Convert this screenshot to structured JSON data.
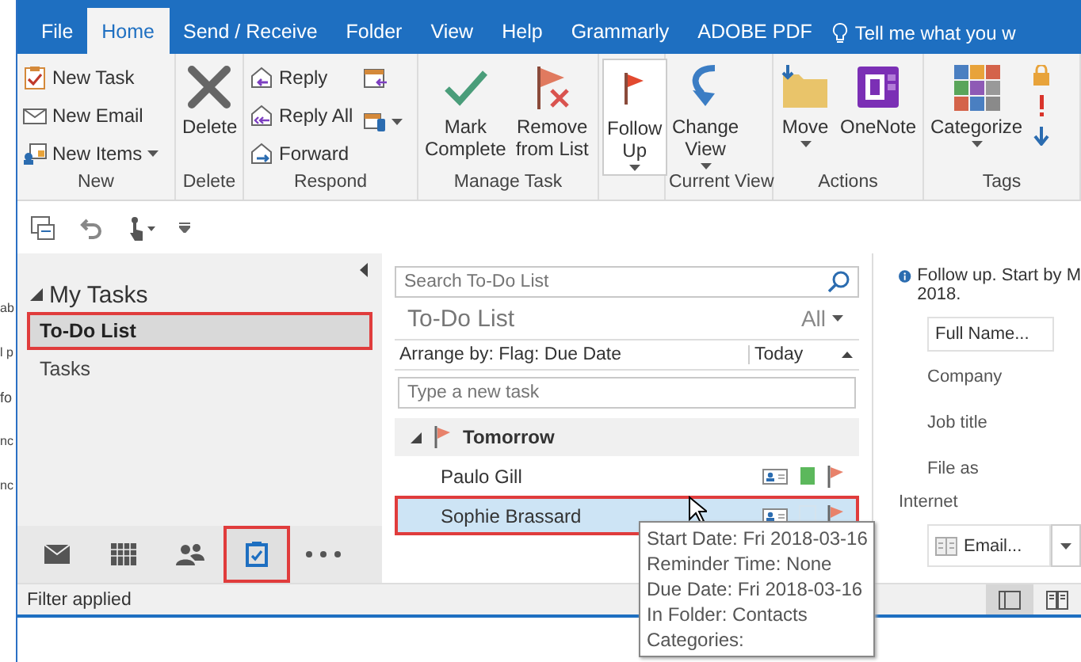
{
  "background_fragments": [
    "ab",
    "l p",
    "fo",
    "nc",
    "nc"
  ],
  "ribbon_tabs": [
    {
      "label": "File",
      "selected": false
    },
    {
      "label": "Home",
      "selected": true
    },
    {
      "label": "Send / Receive",
      "selected": false
    },
    {
      "label": "Folder",
      "selected": false
    },
    {
      "label": "View",
      "selected": false
    },
    {
      "label": "Help",
      "selected": false
    },
    {
      "label": "Grammarly",
      "selected": false
    },
    {
      "label": "ADOBE PDF",
      "selected": false
    }
  ],
  "tell_me": "Tell me what you w",
  "ribbon_groups": [
    {
      "label": "New",
      "buttons": [
        {
          "kind": "small",
          "label": "New Task",
          "dropdown": false
        },
        {
          "kind": "small",
          "label": "New Email",
          "dropdown": false
        },
        {
          "kind": "small",
          "label": "New Items",
          "dropdown": true
        }
      ]
    },
    {
      "label": "Delete",
      "buttons": [
        {
          "kind": "large",
          "label": "Delete",
          "dropdown": false
        }
      ]
    },
    {
      "label": "Respond",
      "buttons": [
        {
          "kind": "small",
          "label": "Reply",
          "dropdown": false
        },
        {
          "kind": "small",
          "label": "Reply All",
          "dropdown": false
        },
        {
          "kind": "small",
          "label": "Forward",
          "dropdown": false
        },
        {
          "kind": "icon",
          "dropdown": false
        },
        {
          "kind": "icon",
          "dropdown": true
        }
      ]
    },
    {
      "label": "Manage Task",
      "buttons": [
        {
          "kind": "large",
          "label": "Mark\nComplete",
          "dropdown": false
        },
        {
          "kind": "large",
          "label": "Remove\nfrom List",
          "dropdown": false
        }
      ]
    },
    {
      "buttons": [
        {
          "kind": "large",
          "label": "Follow\nUp",
          "dropdown": true
        }
      ]
    },
    {
      "label": "Current View",
      "buttons": [
        {
          "kind": "large",
          "label": "Change\nView",
          "dropdown": true
        }
      ]
    },
    {
      "label": "Actions",
      "buttons": [
        {
          "kind": "large",
          "label": "Move",
          "dropdown": true
        },
        {
          "kind": "large",
          "label": "OneNote",
          "dropdown": false
        }
      ]
    },
    {
      "label": "Tags",
      "buttons": [
        {
          "kind": "large",
          "label": "Categorize",
          "dropdown": true
        },
        {
          "kind": "tags",
          "dropdown": false
        }
      ]
    }
  ],
  "nav": {
    "header": "My Tasks",
    "expanded": true,
    "folders": [
      {
        "label": "To-Do List",
        "selected": true
      },
      {
        "label": "Tasks",
        "selected": false
      }
    ],
    "modules": [
      {
        "selected": false
      },
      {
        "selected": false
      },
      {
        "selected": false
      },
      {
        "selected": true
      },
      {
        "selected": false
      }
    ]
  },
  "todo": {
    "search": {
      "placeholder": "Search To-Do List"
    },
    "title": "To-Do List",
    "filter": "All",
    "arrange_by": "Arrange by: Flag: Due Date",
    "sort": "Today",
    "new_task": {
      "placeholder": "Type a new task"
    },
    "group": {
      "label": "Tomorrow",
      "expanded": true
    },
    "tasks": [
      {
        "name": "Paulo Gill",
        "selected": false,
        "color": "#5cb85c"
      },
      {
        "name": "Sophie Brassard",
        "selected": true
      }
    ]
  },
  "tooltip": [
    "Start Date: Fri 2018-03-16",
    "Reminder Time: None",
    "Due Date: Fri 2018-03-16",
    "In Folder: Contacts",
    "Categories:"
  ],
  "reading_pane": {
    "info": [
      "Follow up.  Start by M",
      "2018."
    ],
    "full_name": "Full Name...",
    "labels": [
      "Company",
      "Job title",
      "File as"
    ],
    "section": "Internet",
    "email": "Email..."
  },
  "status_bar": {
    "text": "Filter applied",
    "views": [
      {
        "selected": true
      },
      {
        "selected": false
      }
    ]
  }
}
